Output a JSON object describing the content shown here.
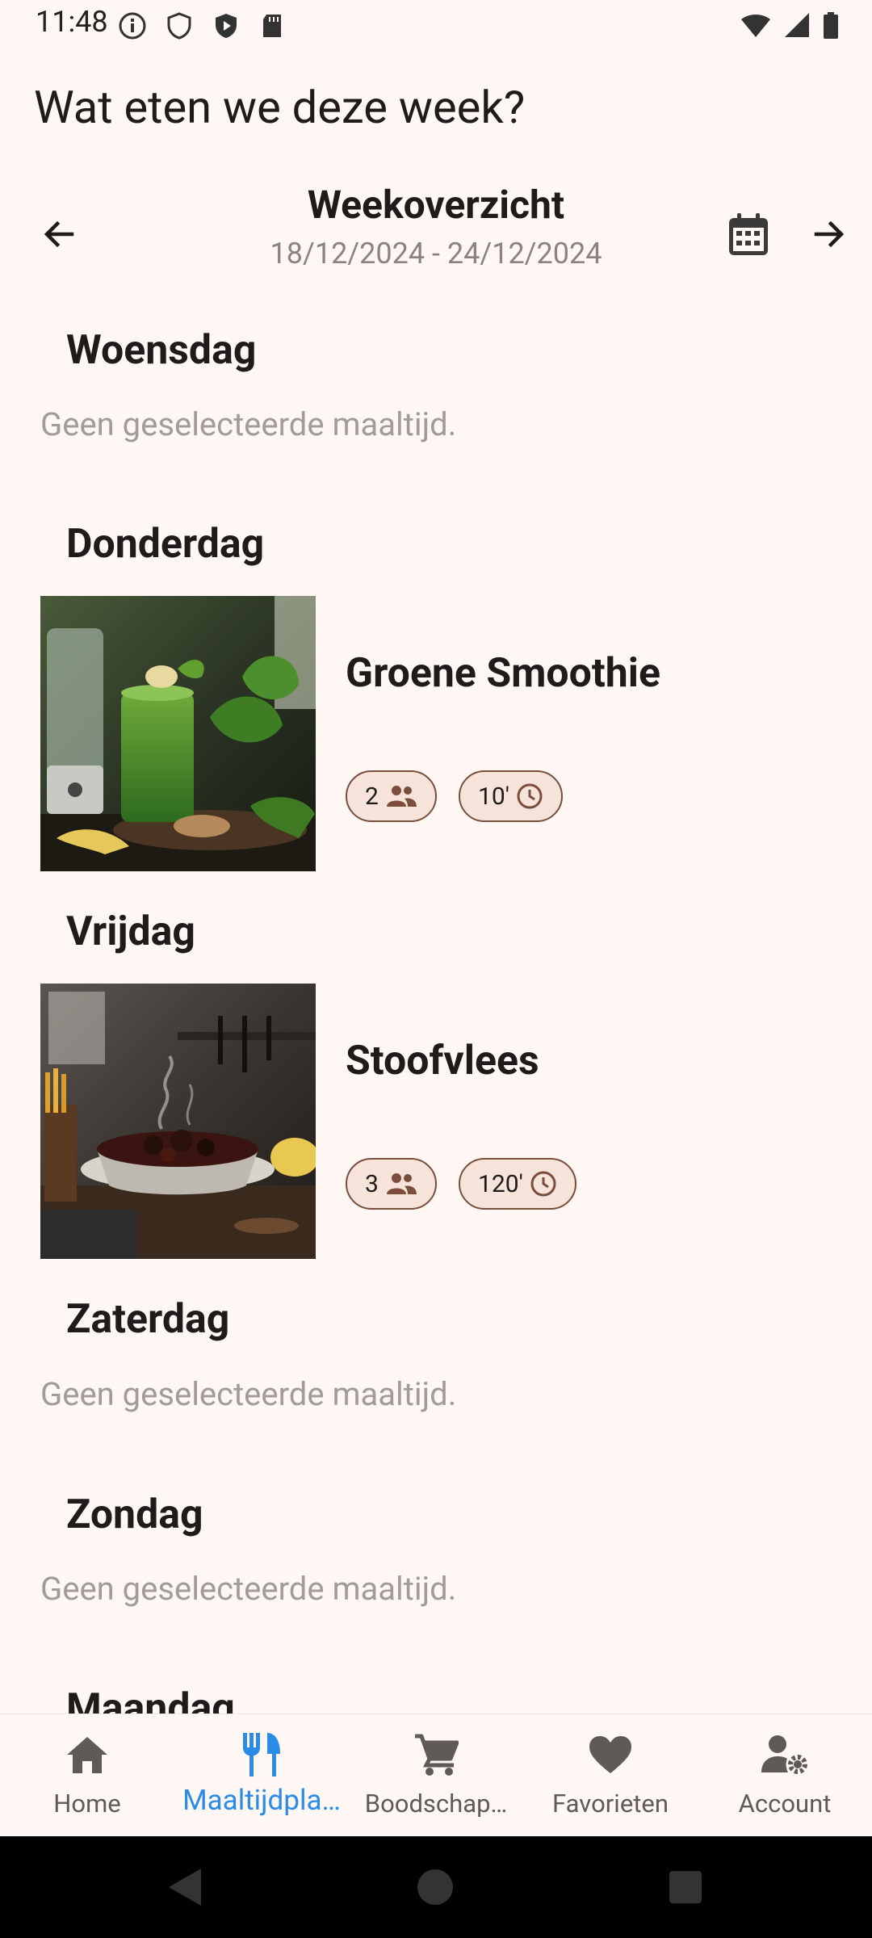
{
  "status_bar": {
    "time": "11:48"
  },
  "app_title": "Wat eten we deze week?",
  "week": {
    "title": "Weekoverzicht",
    "range": "18/12/2024 - 24/12/2024"
  },
  "days": [
    {
      "name": "Woensdag",
      "empty_text": "Geen geselecteerde maaltijd."
    },
    {
      "name": "Donderdag",
      "meal": {
        "name": "Groene Smoothie",
        "persons": "2",
        "time": "10'"
      }
    },
    {
      "name": "Vrijdag",
      "meal": {
        "name": "Stoofvlees",
        "persons": "3",
        "time": "120'"
      }
    },
    {
      "name": "Zaterdag",
      "empty_text": "Geen geselecteerde maaltijd."
    },
    {
      "name": "Zondag",
      "empty_text": "Geen geselecteerde maaltijd."
    },
    {
      "name": "Maandag"
    }
  ],
  "bottom_nav": [
    {
      "label": "Home",
      "icon": "home-icon"
    },
    {
      "label": "Maaltijdpla…",
      "icon": "utensils-icon",
      "active": true
    },
    {
      "label": "Boodschap…",
      "icon": "cart-icon"
    },
    {
      "label": "Favorieten",
      "icon": "heart-icon"
    },
    {
      "label": "Account",
      "icon": "account-settings-icon"
    }
  ],
  "colors": {
    "background": "#fef7f4",
    "accent": "#2a8be8",
    "chip_bg": "#f6e3da",
    "chip_border": "#7a4e3a"
  }
}
